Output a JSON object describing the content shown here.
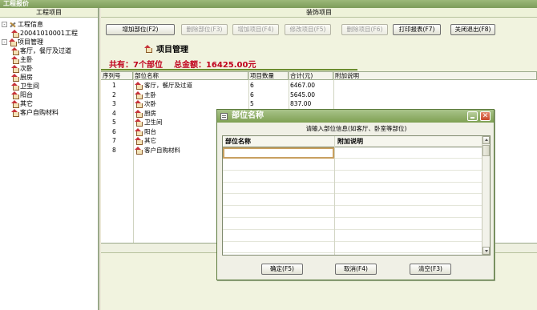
{
  "window": {
    "title": "工程报价"
  },
  "left_pane": {
    "header": "工程项目",
    "tree": [
      {
        "label": "工程信息",
        "kind": "tools",
        "level": 0,
        "toggle": "-"
      },
      {
        "label": "20041010001工程",
        "kind": "house",
        "level": 1
      },
      {
        "label": "项目管理",
        "kind": "house",
        "level": 0,
        "toggle": "-"
      },
      {
        "label": "客厅，餐厅及过道",
        "kind": "house",
        "level": 1
      },
      {
        "label": "主卧",
        "kind": "house",
        "level": 1
      },
      {
        "label": "次卧",
        "kind": "house",
        "level": 1
      },
      {
        "label": "厨房",
        "kind": "house",
        "level": 1
      },
      {
        "label": "卫生间",
        "kind": "house",
        "level": 1
      },
      {
        "label": "阳台",
        "kind": "house",
        "level": 1
      },
      {
        "label": "其它",
        "kind": "house",
        "level": 1
      },
      {
        "label": "客户自购材料",
        "kind": "house",
        "level": 1
      }
    ]
  },
  "right_pane": {
    "header": "装饰项目",
    "toolbar": [
      {
        "label": "增加部位(F2)",
        "enabled": true
      },
      {
        "label": "删除部位(F3)",
        "enabled": false
      },
      {
        "label": "增加项目(F4)",
        "enabled": false
      },
      {
        "label": "修改项目(F5)",
        "enabled": false
      },
      {
        "label": "删除项目(F6)",
        "enabled": false
      },
      {
        "label": "打印报表(F7)",
        "enabled": true
      },
      {
        "label": "关闭退出(F8)",
        "enabled": true
      }
    ],
    "section_title": "项目管理",
    "summary": {
      "count_text": "共有：7个部位",
      "total_text": "总金额：16425.00元"
    },
    "table": {
      "columns": [
        "序列号",
        "部位名称",
        "项目数量",
        "合计(元)",
        "附加说明"
      ],
      "rows": [
        {
          "seq": "1",
          "name": "客厅，餐厅及过道",
          "qty": "6",
          "total": "6467.00",
          "note": ""
        },
        {
          "seq": "2",
          "name": "主卧",
          "qty": "6",
          "total": "5645.00",
          "note": ""
        },
        {
          "seq": "3",
          "name": "次卧",
          "qty": "5",
          "total": "837.00",
          "note": ""
        },
        {
          "seq": "4",
          "name": "厨房",
          "qty": "",
          "total": "",
          "note": ""
        },
        {
          "seq": "5",
          "name": "卫生间",
          "qty": "",
          "total": "",
          "note": ""
        },
        {
          "seq": "6",
          "name": "阳台",
          "qty": "",
          "total": "",
          "note": ""
        },
        {
          "seq": "7",
          "name": "其它",
          "qty": "",
          "total": "",
          "note": ""
        },
        {
          "seq": "8",
          "name": "客户自购材料",
          "qty": "",
          "total": "",
          "note": ""
        }
      ]
    }
  },
  "dialog": {
    "title": "部位名称",
    "prompt": "请输入部位信息(如客厅、卧室等部位)",
    "columns": [
      "部位名称",
      "附加说明"
    ],
    "input_value": "",
    "buttons": {
      "ok": "确定(F5)",
      "cancel": "取消(F4)",
      "clear": "清空(F3)"
    }
  },
  "colors": {
    "accent": "#7ea053",
    "summary_red": "#c0001c",
    "house_roof": "#c8323a"
  }
}
